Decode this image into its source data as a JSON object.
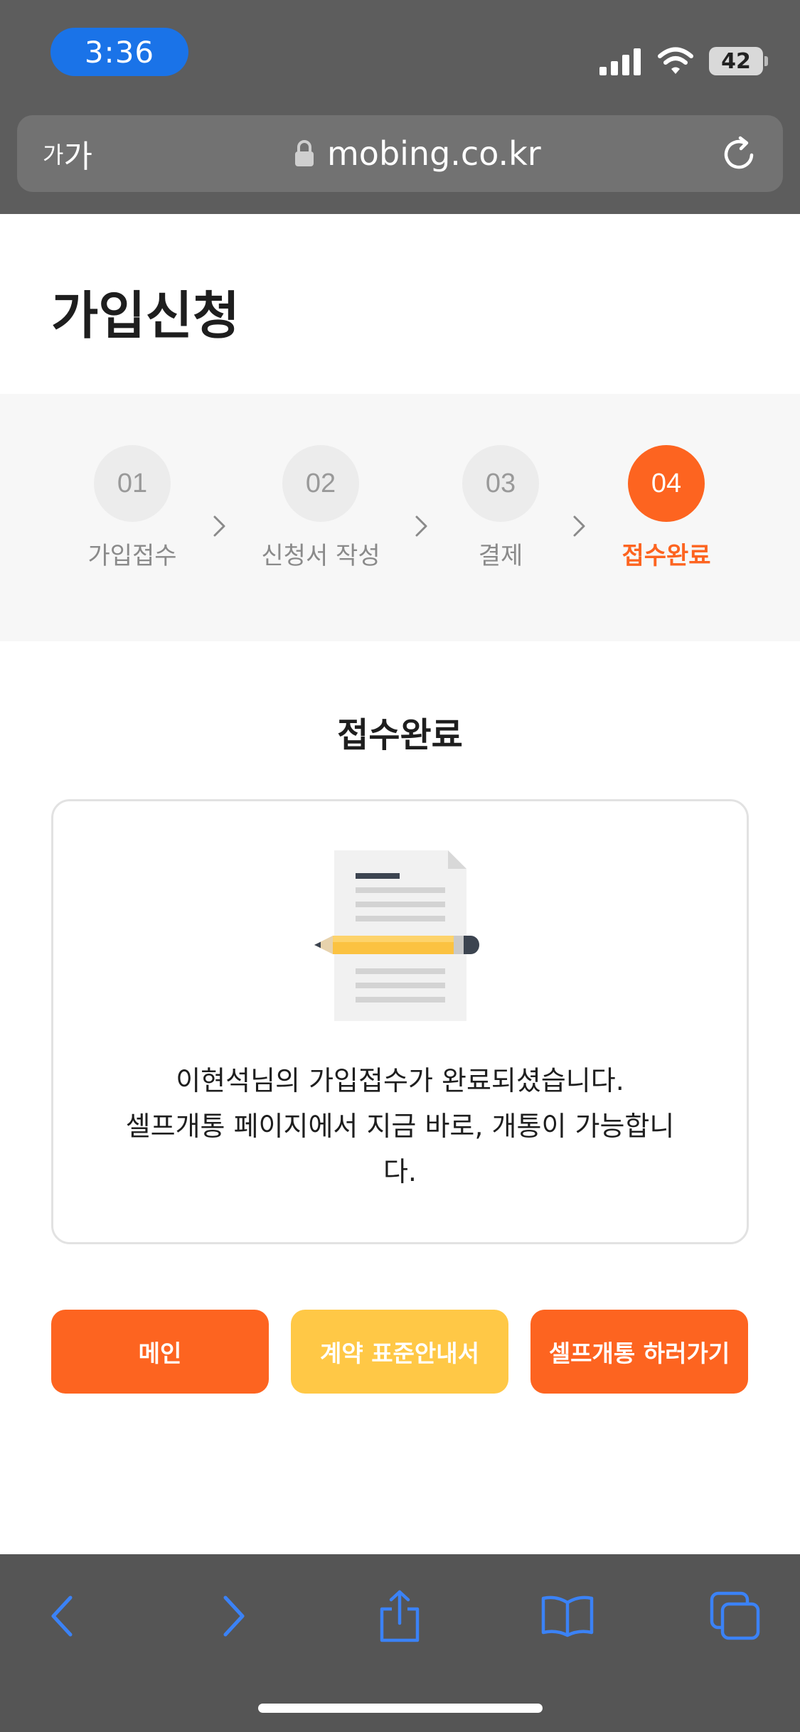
{
  "status_bar": {
    "time": "3:36",
    "battery": "42"
  },
  "browser": {
    "aa_small": "가",
    "aa_large": "가",
    "url": "mobing.co.kr",
    "icons": {
      "lock": "lock-icon",
      "reload": "reload-icon",
      "back": "chevron-left-icon",
      "forward": "chevron-right-icon",
      "share": "share-icon",
      "bookmarks": "book-icon",
      "tabs": "tabs-icon"
    }
  },
  "page": {
    "title": "가입신청",
    "steps": [
      {
        "number": "01",
        "label": "가입접수",
        "active": false
      },
      {
        "number": "02",
        "label": "신청서 작성",
        "active": false
      },
      {
        "number": "03",
        "label": "결제",
        "active": false
      },
      {
        "number": "04",
        "label": "접수완료",
        "active": true
      }
    ],
    "section_title": "접수완료",
    "message_line1": "이현석님의 가입접수가 완료되셨습니다.",
    "message_line2": "셀프개통 페이지에서 지금 바로, 개통이 가능합니",
    "message_line3": "다.",
    "buttons": {
      "main": "메인",
      "guide": "계약 표준안내서",
      "self_activation": "셀프개통 하러가기"
    }
  },
  "colors": {
    "accent_orange": "#fd6420",
    "accent_yellow": "#ffc846",
    "browser_blue": "#3b82f6"
  }
}
